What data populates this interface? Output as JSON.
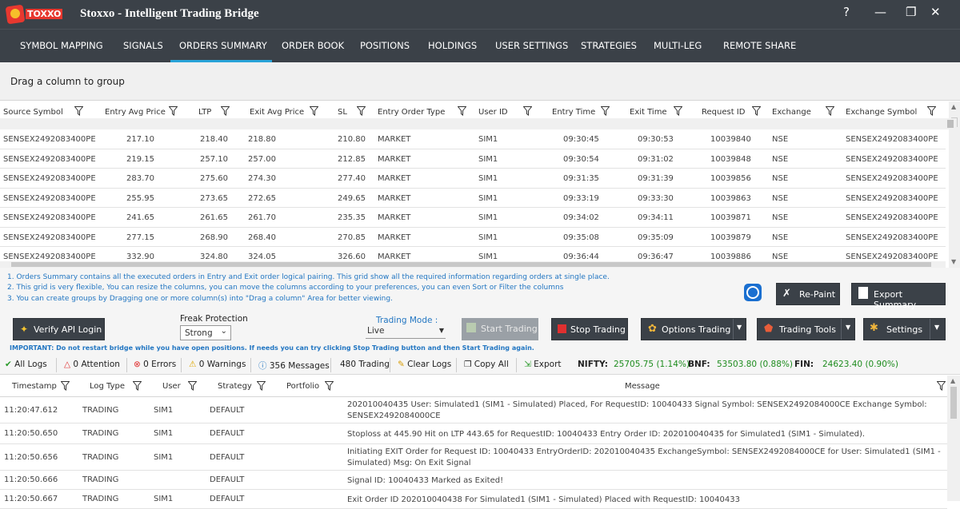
{
  "app": {
    "logo_text": "TOXXO",
    "title": "Stoxxo - Intelligent Trading Bridge",
    "help": "?",
    "minimize": "—",
    "restore": "❐",
    "close": "✕"
  },
  "nav": [
    "SYMBOL MAPPING",
    "SIGNALS",
    "ORDERS SUMMARY",
    "ORDER BOOK",
    "POSITIONS",
    "HOLDINGS",
    "USER SETTINGS",
    "STRATEGIES",
    "MULTI-LEG",
    "REMOTE SHARE"
  ],
  "active_tab": "ORDERS SUMMARY",
  "group_hint": "Drag a column to group",
  "orders": {
    "columns": [
      "Source Symbol",
      "Entry Avg Price",
      "LTP",
      "Exit Avg Price",
      "SL",
      "Entry Order Type",
      "User ID",
      "Entry Time",
      "Exit Time",
      "Request ID",
      "Exchange",
      "Exchange Symbol"
    ],
    "rows": [
      [
        "SENSEX2492083400PE",
        "217.10",
        "218.40",
        "218.80",
        "210.80",
        "MARKET",
        "SIM1",
        "09:30:45",
        "09:30:53",
        "10039840",
        "NSE",
        "SENSEX2492083400PE"
      ],
      [
        "SENSEX2492083400PE",
        "219.15",
        "257.10",
        "257.00",
        "212.85",
        "MARKET",
        "SIM1",
        "09:30:54",
        "09:31:02",
        "10039848",
        "NSE",
        "SENSEX2492083400PE"
      ],
      [
        "SENSEX2492083400PE",
        "283.70",
        "275.60",
        "274.30",
        "277.40",
        "MARKET",
        "SIM1",
        "09:31:35",
        "09:31:39",
        "10039856",
        "NSE",
        "SENSEX2492083400PE"
      ],
      [
        "SENSEX2492083400PE",
        "255.95",
        "273.65",
        "272.65",
        "249.65",
        "MARKET",
        "SIM1",
        "09:33:19",
        "09:33:30",
        "10039863",
        "NSE",
        "SENSEX2492083400PE"
      ],
      [
        "SENSEX2492083400PE",
        "241.65",
        "261.65",
        "261.70",
        "235.35",
        "MARKET",
        "SIM1",
        "09:34:02",
        "09:34:11",
        "10039871",
        "NSE",
        "SENSEX2492083400PE"
      ],
      [
        "SENSEX2492083400PE",
        "277.15",
        "268.90",
        "268.40",
        "270.85",
        "MARKET",
        "SIM1",
        "09:35:08",
        "09:35:09",
        "10039879",
        "NSE",
        "SENSEX2492083400PE"
      ],
      [
        "SENSEX2492083400PE",
        "332.90",
        "324.80",
        "324.05",
        "326.60",
        "MARKET",
        "SIM1",
        "09:36:44",
        "09:36:47",
        "10039886",
        "NSE",
        "SENSEX2492083400PE"
      ]
    ]
  },
  "notes": [
    "1. Orders Summary contains all the executed orders in Entry and Exit order logical pairing. This grid show all the required information regarding orders at single place.",
    "2. This grid is very flexible, You can resize the columns, you can move the columns according to your preferences, you can even Sort or Filter the columns",
    "3. You can create groups by Dragging one or more column(s) into \"Drag a column\" Area for better viewing."
  ],
  "buttons": {
    "repaint": "Re-Paint",
    "export_summary": "Export Summary",
    "verify_api": "Verify API Login",
    "start_trading": "Start Trading",
    "stop_trading": "Stop Trading",
    "options_trading": "Options Trading",
    "trading_tools": "Trading Tools",
    "settings": "Settings"
  },
  "freak": {
    "label": "Freak Protection",
    "value": "Strong"
  },
  "trading_mode": {
    "label": "Trading Mode :",
    "value": "Live"
  },
  "important": "IMPORTANT: Do not restart bridge while you have open positions. If needs you can try clicking Stop Trading button and then Start Trading again.",
  "log_tabs": {
    "all_logs": "All Logs",
    "attention": "0 Attention",
    "errors": "0 Errors",
    "warnings": "0 Warnings",
    "messages": "356 Messages",
    "trading": "480 Trading",
    "clear_logs": "Clear Logs",
    "copy_all": "Copy All",
    "export": "Export"
  },
  "indices": [
    {
      "label": "NIFTY:",
      "value": "25705.75 (1.14%)"
    },
    {
      "label": "BNF:",
      "value": "53503.80 (0.88%)"
    },
    {
      "label": "FIN:",
      "value": "24623.40 (0.90%)"
    }
  ],
  "logs": {
    "columns": [
      "Timestamp",
      "Log Type",
      "User",
      "Strategy",
      "Portfolio",
      "Message"
    ],
    "rows": [
      {
        "ts": "11:20:47.612",
        "type": "TRADING",
        "user": "SIM1",
        "strategy": "DEFAULT",
        "msg": "202010040435 User: Simulated1 (SIM1 - Simulated) Placed, For RequestID: 10040433  Signal Symbol: SENSEX2492084000CE  Exchange Symbol: SENSEX2492084000CE"
      },
      {
        "ts": "11:20:50.650",
        "type": "TRADING",
        "user": "SIM1",
        "strategy": "DEFAULT",
        "msg": "Stoploss at 445.90 Hit on LTP 443.65 for RequestID: 10040433  Entry Order ID: 202010040435  for Simulated1 (SIM1 - Simulated)."
      },
      {
        "ts": "11:20:50.656",
        "type": "TRADING",
        "user": "SIM1",
        "strategy": "DEFAULT",
        "msg": "Initiating EXIT Order for Request ID: 10040433  EntryOrderID: 202010040435  ExchangeSymbol: SENSEX2492084000CE  for User: Simulated1 (SIM1 - Simulated) Msg: On Exit Signal"
      },
      {
        "ts": "11:20:50.666",
        "type": "TRADING",
        "user": "",
        "strategy": "DEFAULT",
        "msg": "Signal ID: 10040433 Marked as Exited!"
      },
      {
        "ts": "11:20:50.667",
        "type": "TRADING",
        "user": "SIM1",
        "strategy": "DEFAULT",
        "msg": "Exit Order ID 202010040438 For Simulated1 (SIM1 - Simulated) Placed with RequestID: 10040433"
      }
    ]
  },
  "colors": {
    "dark": "#3b4148",
    "accent": "#29a3d8",
    "link": "#2276c2",
    "green": "#1e8c1e"
  }
}
